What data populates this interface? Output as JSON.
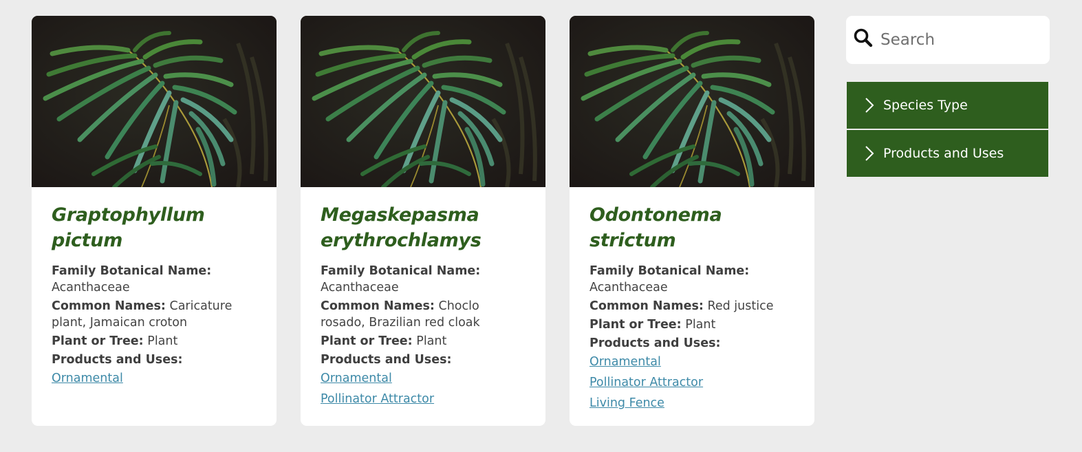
{
  "search": {
    "placeholder": "Search"
  },
  "filters": [
    {
      "label": "Species Type"
    },
    {
      "label": "Products and Uses"
    }
  ],
  "field_labels": {
    "family": "Family Botanical Name:",
    "common": "Common Names:",
    "plant_or_tree": "Plant or Tree:",
    "uses": "Products and Uses:"
  },
  "cards": [
    {
      "title": "Graptophyllum pictum",
      "family": "Acanthaceae",
      "common_names": "Caricature plant, Jamaican croton",
      "plant_or_tree": "Plant",
      "uses": [
        "Ornamental"
      ]
    },
    {
      "title": "Megaskepasma erythrochlamys",
      "family": "Acanthaceae",
      "common_names": "Choclo rosado, Brazilian red cloak",
      "plant_or_tree": "Plant",
      "uses": [
        "Ornamental",
        "Pollinator Attractor"
      ]
    },
    {
      "title": "Odontonema strictum",
      "family": "Acanthaceae",
      "common_names": "Red justice",
      "plant_or_tree": "Plant",
      "uses": [
        "Ornamental",
        "Pollinator Attractor",
        "Living Fence"
      ]
    }
  ],
  "colors": {
    "accent_green": "#2e5e1e",
    "link_blue": "#3e8aa8",
    "page_background": "#ececec"
  },
  "icons": {
    "search": "search-icon",
    "filter_expand": "chevron-right-icon"
  }
}
